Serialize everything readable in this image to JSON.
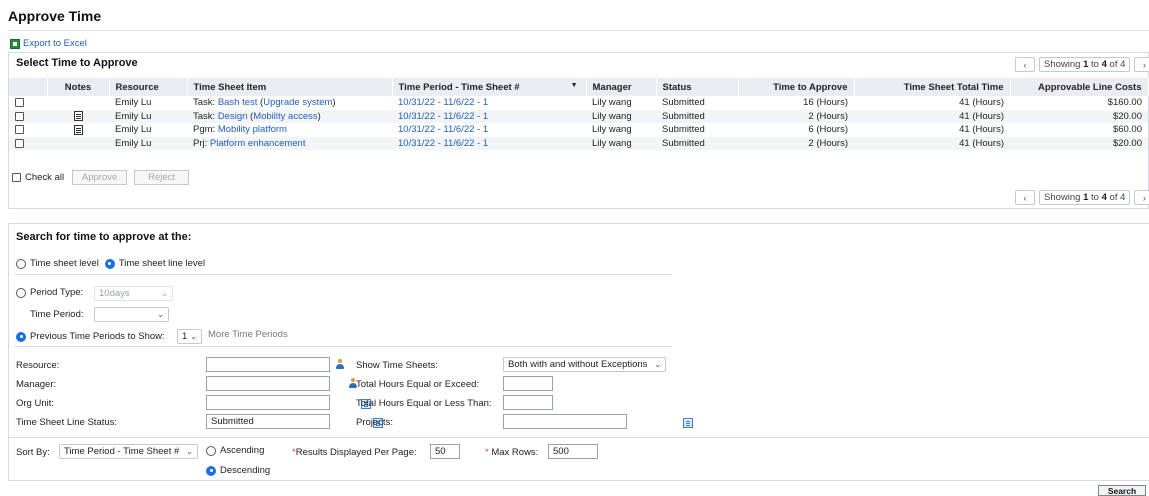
{
  "page": {
    "title": "Approve Time",
    "export_label": "Export to Excel"
  },
  "approve_section": {
    "title": "Select Time to Approve",
    "pager": {
      "prefix": "Showing",
      "from": "1",
      "to_word": "to",
      "to": "4",
      "of_word": "of",
      "total": "4"
    },
    "columns": [
      "Notes",
      "Resource",
      "Time Sheet Item",
      "Time Period - Time Sheet #",
      "Manager",
      "Status",
      "Time to Approve",
      "Time Sheet Total Time",
      "Approvable Line Costs"
    ],
    "rows": [
      {
        "has_note": false,
        "resource": "Emily Lu",
        "item_prefix": "Task: ",
        "item_link": "Bash test",
        "item_open": " (",
        "item_link2": "Upgrade system",
        "item_close": ")",
        "period": "10/31/22 - 11/6/22 - 1",
        "manager": "Lily wang",
        "status": "Submitted",
        "time_to_approve": "16 (Hours)",
        "total_time": "41 (Hours)",
        "cost": "$160.00"
      },
      {
        "has_note": true,
        "resource": "Emily Lu",
        "item_prefix": "Task: ",
        "item_link": "Design",
        "item_open": " (",
        "item_link2": "Mobility access",
        "item_close": ")",
        "period": "10/31/22 - 11/6/22 - 1",
        "manager": "Lily wang",
        "status": "Submitted",
        "time_to_approve": "2 (Hours)",
        "total_time": "41 (Hours)",
        "cost": "$20.00"
      },
      {
        "has_note": true,
        "resource": "Emily Lu",
        "item_prefix": "Pgm: ",
        "item_link": "Mobility platform",
        "item_open": "",
        "item_link2": "",
        "item_close": "",
        "period": "10/31/22 - 11/6/22 - 1",
        "manager": "Lily wang",
        "status": "Submitted",
        "time_to_approve": "6 (Hours)",
        "total_time": "41 (Hours)",
        "cost": "$60.00"
      },
      {
        "has_note": false,
        "resource": "Emily Lu",
        "item_prefix": "Prj: ",
        "item_link": "Platform enhancement",
        "item_open": "",
        "item_link2": "",
        "item_close": "",
        "period": "10/31/22 - 11/6/22 - 1",
        "manager": "Lily wang",
        "status": "Submitted",
        "time_to_approve": "2 (Hours)",
        "total_time": "41 (Hours)",
        "cost": "$20.00"
      }
    ],
    "check_all_label": "Check all",
    "approve_label": "Approve",
    "reject_label": "Reject"
  },
  "search_section": {
    "title": "Search for time to approve at the:",
    "level_sheet": "Time sheet level",
    "level_line": "Time sheet line level",
    "period_type_label": "Period Type:",
    "period_type_value": "10days",
    "time_period_label": "Time Period:",
    "time_period_value": "",
    "previous_label": "Previous Time Periods to Show:",
    "previous_value": "1",
    "more_periods": "More Time Periods",
    "resource_label": "Resource:",
    "resource_value": "",
    "manager_label": "Manager:",
    "manager_value": "",
    "org_unit_label": "Org Unit:",
    "org_unit_value": "",
    "line_status_label": "Time Sheet Line Status:",
    "line_status_value": "Submitted",
    "show_sheets_label": "Show Time Sheets:",
    "show_sheets_value": "Both with and without Exceptions",
    "hours_exceed_label": "Total Hours Equal or Exceed:",
    "hours_exceed_value": "",
    "hours_less_label": "Total Hours Equal or Less Than:",
    "hours_less_value": "",
    "projects_label": "Projects:",
    "projects_value": "",
    "sort_by_label": "Sort By:",
    "sort_by_value": "Time Period - Time Sheet #",
    "ascending": "Ascending",
    "descending": "Descending",
    "req_mark": "*",
    "results_per_page_label": "Results Displayed Per Page:",
    "results_per_page_value": "50",
    "max_rows_label": " Max Rows:",
    "max_rows_value": "500",
    "search_label": "Search"
  }
}
